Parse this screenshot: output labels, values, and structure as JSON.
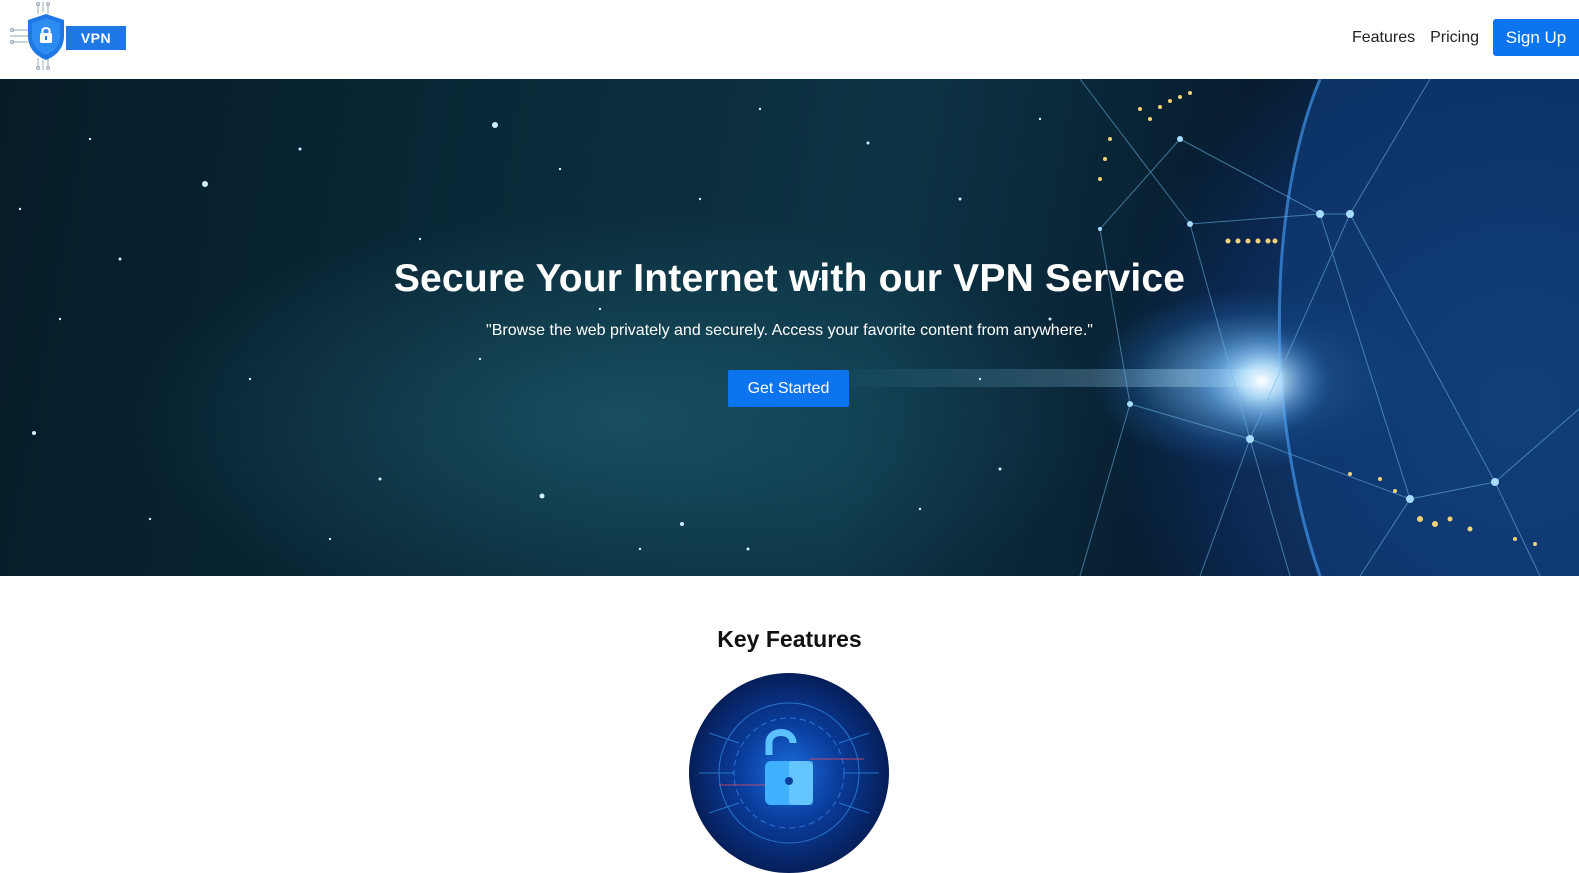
{
  "header": {
    "logo_text": "VPN",
    "nav": {
      "features_label": "Features",
      "pricing_label": "Pricing",
      "signup_label": "Sign Up"
    }
  },
  "hero": {
    "title": "Secure Your Internet with our VPN Service",
    "subtitle": "\"Browse the web privately and securely. Access your favorite content from anywhere.\"",
    "cta_label": "Get Started"
  },
  "features": {
    "title": "Key Features",
    "image_icon": "padlock-icon"
  },
  "colors": {
    "accent": "#0d74f0",
    "logo_blue": "#1f77e6",
    "hero_dark": "#061b28"
  }
}
